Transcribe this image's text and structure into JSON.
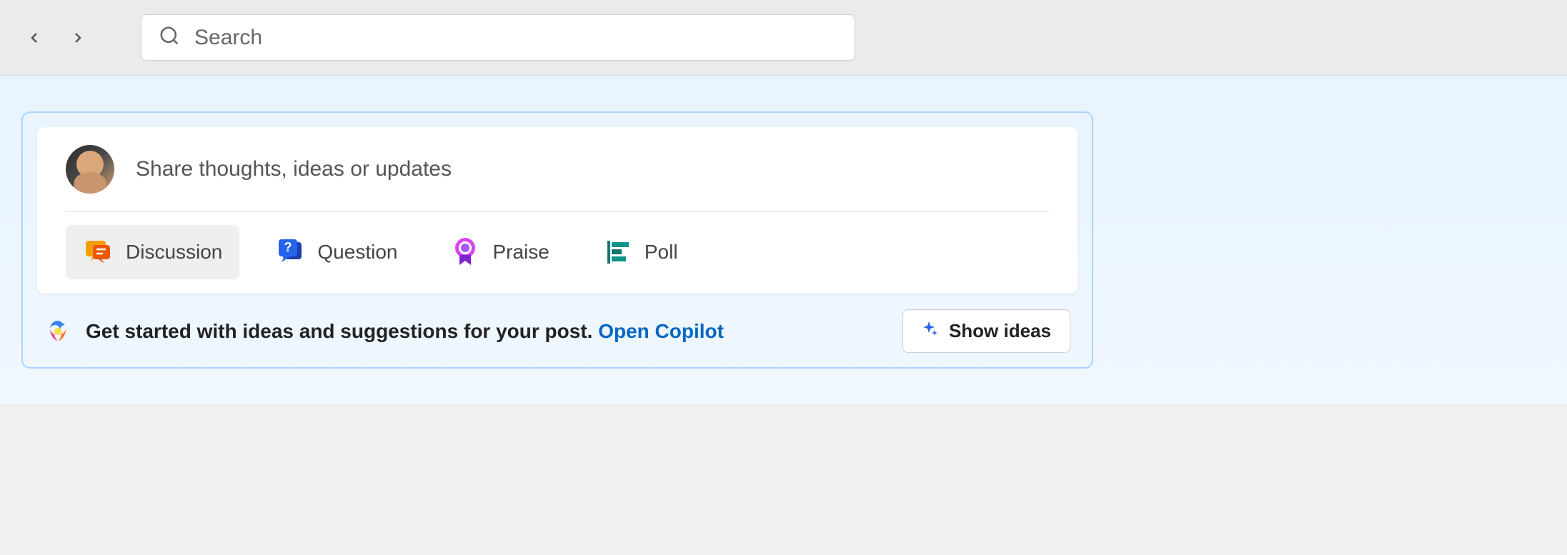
{
  "header": {
    "search_placeholder": "Search"
  },
  "compose": {
    "placeholder": "Share thoughts, ideas or updates",
    "post_types": {
      "discussion": "Discussion",
      "question": "Question",
      "praise": "Praise",
      "poll": "Poll"
    }
  },
  "copilot": {
    "prompt_text": "Get started with ideas and suggestions for your post. ",
    "link_text": "Open Copilot",
    "button_label": "Show ideas"
  }
}
